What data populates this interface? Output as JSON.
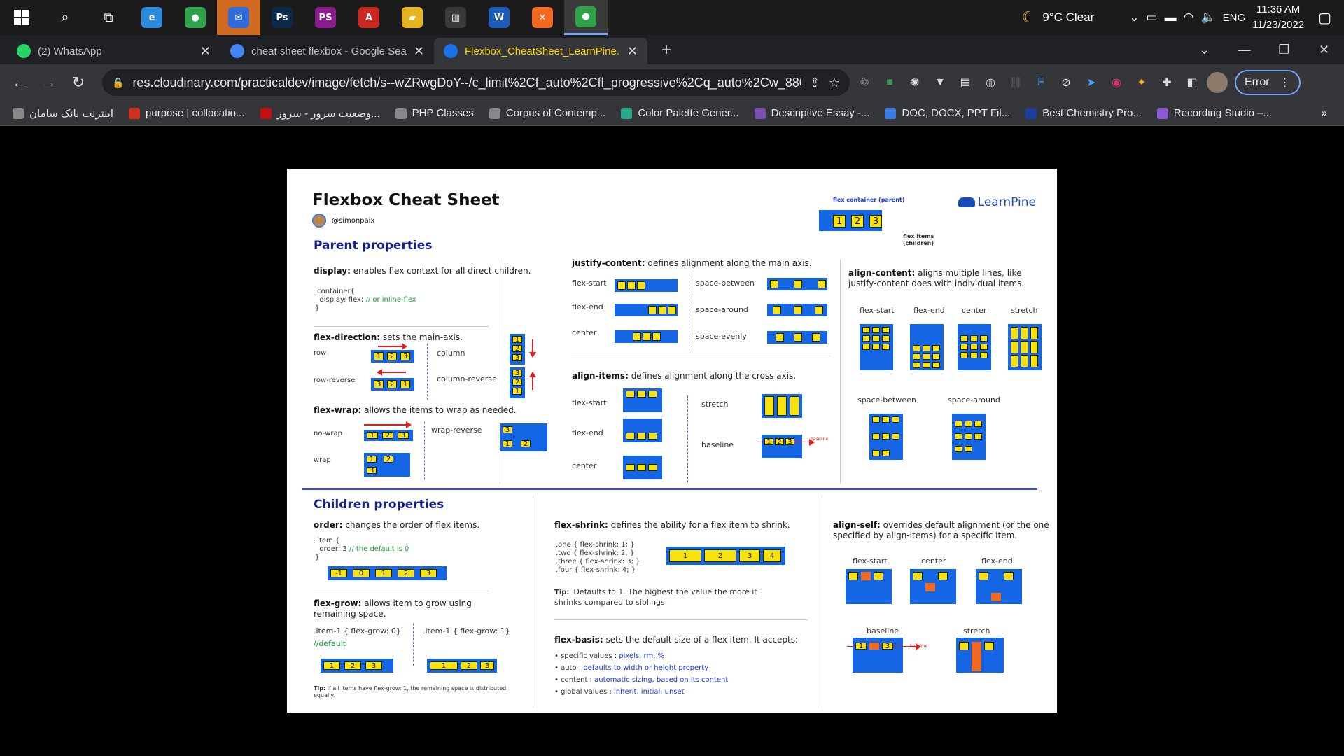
{
  "taskbar": {
    "apps": [
      {
        "icon": "edge-icon",
        "color": "#2b8bd9",
        "glyph": "e"
      },
      {
        "icon": "chrome-icon",
        "color": "#2fa24a",
        "glyph": "●"
      },
      {
        "icon": "thunderbird-icon",
        "color": "#2f6bd9",
        "glyph": "✉"
      },
      {
        "icon": "photoshop-icon",
        "color": "#0b2a4a",
        "glyph": "Ps"
      },
      {
        "icon": "phpstorm-icon",
        "color": "#8a1d8e",
        "glyph": "PS"
      },
      {
        "icon": "acrobat-icon",
        "color": "#c8281e",
        "glyph": "A"
      },
      {
        "icon": "file-explorer-icon",
        "color": "#e6b420",
        "glyph": "▰"
      },
      {
        "icon": "reader-icon",
        "color": "#3a3a3a",
        "glyph": "▥"
      },
      {
        "icon": "word-icon",
        "color": "#1c5bb8",
        "glyph": "W"
      },
      {
        "icon": "xampp-icon",
        "color": "#f26a22",
        "glyph": "✕"
      },
      {
        "icon": "chrome-icon",
        "color": "#2fa24a",
        "glyph": "●"
      }
    ],
    "weather": "9°C  Clear",
    "language": "ENG",
    "time": "11:36 AM",
    "date": "11/23/2022"
  },
  "tabs": [
    {
      "title": "(2) WhatsApp",
      "favicon_color": "#25d366"
    },
    {
      "title": "cheat sheet flexbox - Google Sea",
      "favicon_color": "#4285f4"
    },
    {
      "title": "Flexbox_CheatSheet_LearnPine.p",
      "favicon_color": "#1a73e8"
    }
  ],
  "new_tab": "+",
  "toolbar": {
    "url": "res.cloudinary.com/practicaldev/image/fetch/s--wZRwgDoY--/c_limit%2Cf_auto%2Cfl_progressive%2Cq_auto%2Cw_880/...",
    "error_label": "Error"
  },
  "bookmarks": [
    {
      "label": "اینترنت بانک سامان",
      "color": "#888"
    },
    {
      "label": "purpose | collocatio...",
      "color": "#d0321e"
    },
    {
      "label": "وضعیت سرور - سرور...",
      "color": "#c01010"
    },
    {
      "label": "PHP Classes",
      "color": "#888"
    },
    {
      "label": "Corpus of Contemp...",
      "color": "#888"
    },
    {
      "label": "Color Palette Gener...",
      "color": "#2aa58a"
    },
    {
      "label": "Descriptive Essay -...",
      "color": "#7a4fb0"
    },
    {
      "label": "DOC, DOCX, PPT Fil...",
      "color": "#3a7be0"
    },
    {
      "label": "Best Chemistry Pro...",
      "color": "#1c3f9e"
    },
    {
      "label": "Recording Studio –...",
      "color": "#8a5bd0"
    }
  ],
  "bookmarks_more": "»",
  "sheet": {
    "title": "Flexbox Cheat Sheet",
    "author": "@simonpaix",
    "brand": "LearnPine",
    "flex_container_label": "flex container (parent)",
    "flex_items_label": "flex items (children)",
    "parent_heading": "Parent properties",
    "children_heading": "Children properties",
    "display_title": "display:",
    "display_desc": " enables flex context for all direct children.",
    "display_code": ".container{\n  display: flex;",
    "display_code_comment": "// or inline-flex",
    "display_code_end": "}",
    "flex_direction_title": "flex-direction:",
    "flex_direction_desc": " sets the main-axis.",
    "fd_row": "row",
    "fd_column": "column",
    "fd_row_reverse": "row-reverse",
    "fd_column_reverse": "column-reverse",
    "flex_wrap_title": "flex-wrap:",
    "flex_wrap_desc": " allows the items to wrap as needed.",
    "fw_nowrap": "no-wrap",
    "fw_wrap_reverse": "wrap-reverse",
    "fw_wrap": "wrap",
    "justify_title": "justify-content:",
    "justify_desc": " defines alignment along the main axis.",
    "jc_flex_start": "flex-start",
    "jc_flex_end": "flex-end",
    "jc_center": "center",
    "jc_space_between": "space-between",
    "jc_space_around": "space-around",
    "jc_space_evenly": "space-evenly",
    "align_items_title": "align-items:",
    "align_items_desc": " defines alignment along the cross axis.",
    "ai_flex_start": "flex-start",
    "ai_flex_end": "flex-end",
    "ai_center": "center",
    "ai_stretch": "stretch",
    "ai_baseline": "baseline",
    "baseline_small": "baseline",
    "align_content_title": "align-content:",
    "align_content_desc": " aligns multiple lines, like justify-content does with individual items.",
    "ac_flex_start": "flex-start",
    "ac_flex_end": "flex-end",
    "ac_center": "center",
    "ac_stretch": "stretch",
    "ac_space_between": "space-between",
    "ac_space_around": "space-around",
    "order_title": "order:",
    "order_desc": " changes the order of flex items.",
    "order_code": ".item {\n  order: 3",
    "order_comment": "// the default is 0",
    "order_code_end": "}",
    "order_values": [
      "-1",
      "0",
      "1",
      "2",
      "3"
    ],
    "flex_grow_title": "flex-grow:",
    "flex_grow_desc": " allows item to grow using remaining space.",
    "fg_code1": ".item-1 { flex-grow: 0}",
    "fg_default": "//default",
    "fg_code2": ".item-1 { flex-grow: 1}",
    "fg_tip_label": "Tip:",
    "fg_tip": "If all items have flex-grow: 1, the remaining space is distributed equally.",
    "flex_shrink_title": "flex-shrink:",
    "flex_shrink_desc": " defines the ability for a flex item to shrink.",
    "fs_code": ".one { flex-shrink: 1; }\n.two { flex-shrink: 2; }\n.three { flex-shrink: 3; }\n.four { flex-shrink: 4; }",
    "fs_values": [
      "1",
      "2",
      "3",
      "4"
    ],
    "fs_tip_label": "Tip:",
    "fs_tip": "Defaults to 1. The highest the value the more it shrinks compared to siblings.",
    "flex_basis_title": "flex-basis:",
    "flex_basis_desc": " sets the default size of a flex item. It accepts:",
    "fb_items": [
      {
        "k": "specific values",
        "v": "pixels, rm, %"
      },
      {
        "k": "auto",
        "v": "defaults to width or height property"
      },
      {
        "k": "content",
        "v": "automatic sizing, based on its content"
      },
      {
        "k": "global values",
        "v": "inherit, initial, unset"
      }
    ],
    "align_self_title": "align-self:",
    "align_self_desc": " overrides default alignment (or the one specified by align-items) for a specific item.",
    "as_flex_start": "flex-start",
    "as_center": "center",
    "as_flex_end": "flex-end",
    "as_baseline": "baseline",
    "as_stretch": "stretch",
    "nums": [
      "1",
      "2",
      "3"
    ]
  }
}
